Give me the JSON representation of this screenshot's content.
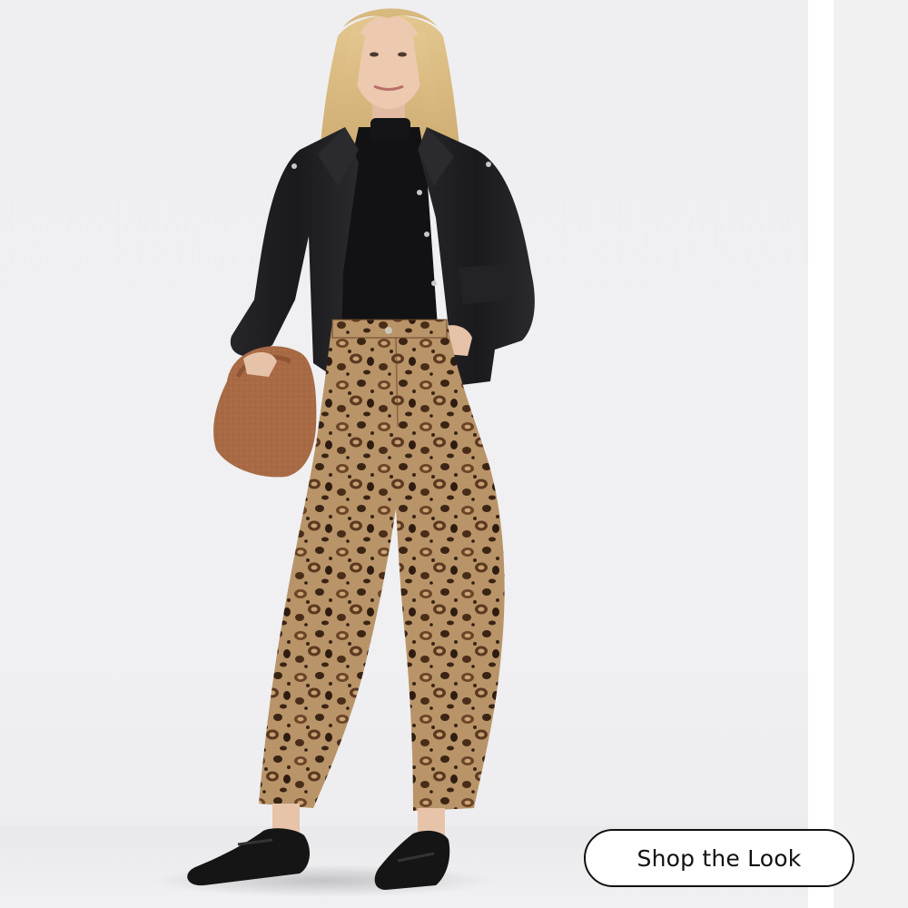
{
  "cta": {
    "label": "Shop the Look"
  },
  "colors": {
    "backdrop": "#efeff1",
    "jacket": "#1c1c1e",
    "turtleneck": "#121214",
    "hair": "#d8b97e",
    "skin": "#e9c6ad",
    "pants_base": "#b89468",
    "leopard_spot": "#3a2414",
    "bag": "#a86a44",
    "loafers": "#151515",
    "button_border": "#111111",
    "button_bg": "#ffffff"
  },
  "photo": {
    "subject": "model-in-leather-jacket-and-leopard-pants"
  }
}
